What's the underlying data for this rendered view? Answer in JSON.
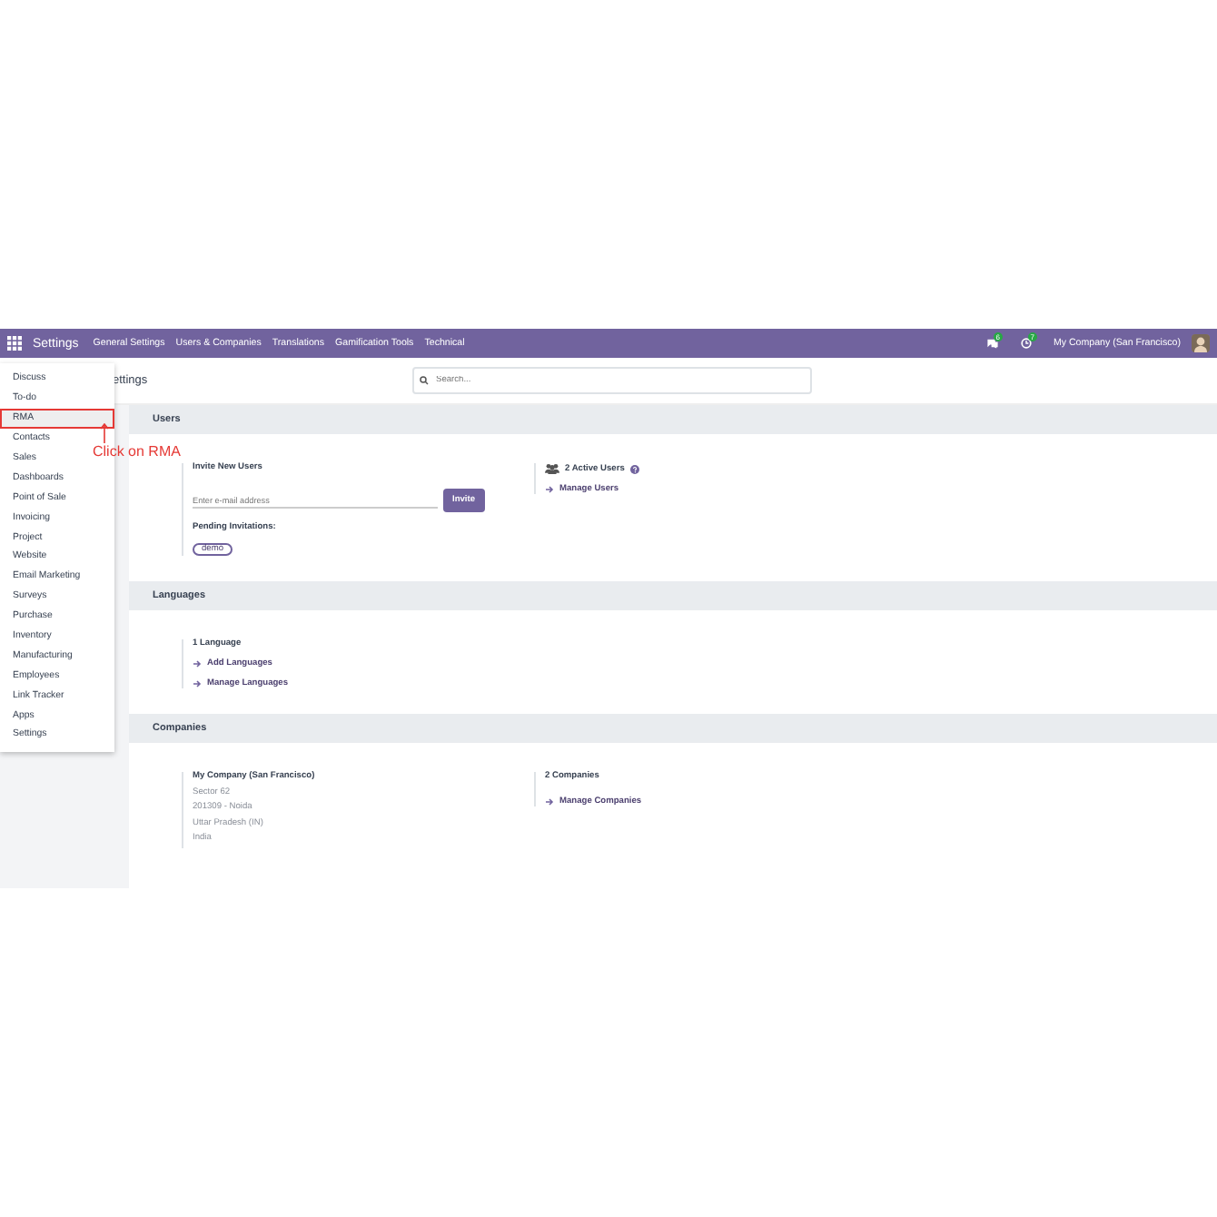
{
  "navbar": {
    "app_name": "Settings",
    "menu": [
      "General Settings",
      "Users & Companies",
      "Translations",
      "Gamification Tools",
      "Technical"
    ],
    "messages_badge": "6",
    "activities_badge": "7",
    "company": "My Company (San Francisco)"
  },
  "breadcrumb": "ettings",
  "search": {
    "placeholder": "Search..."
  },
  "app_menu": {
    "items": [
      {
        "label": "Discuss",
        "highlighted": false
      },
      {
        "label": "To-do",
        "highlighted": false
      },
      {
        "label": "RMA",
        "highlighted": true
      },
      {
        "label": "Contacts",
        "highlighted": false
      },
      {
        "label": "Sales",
        "highlighted": false
      },
      {
        "label": "Dashboards",
        "highlighted": false
      },
      {
        "label": "Point of Sale",
        "highlighted": false
      },
      {
        "label": "Invoicing",
        "highlighted": false
      },
      {
        "label": "Project",
        "highlighted": false
      },
      {
        "label": "Website",
        "highlighted": false
      },
      {
        "label": "Email Marketing",
        "highlighted": false
      },
      {
        "label": "Surveys",
        "highlighted": false
      },
      {
        "label": "Purchase",
        "highlighted": false
      },
      {
        "label": "Inventory",
        "highlighted": false
      },
      {
        "label": "Manufacturing",
        "highlighted": false
      },
      {
        "label": "Employees",
        "highlighted": false
      },
      {
        "label": "Link Tracker",
        "highlighted": false
      },
      {
        "label": "Apps",
        "highlighted": false
      },
      {
        "label": "Settings",
        "highlighted": false
      }
    ]
  },
  "annotation": {
    "text": "Click on RMA"
  },
  "users": {
    "title": "Users",
    "invite_label": "Invite New Users",
    "email_placeholder": "Enter e-mail address",
    "invite_button": "Invite",
    "pending_label": "Pending Invitations:",
    "pending": [
      "demo"
    ],
    "active_users": "2 Active Users",
    "manage_link": "Manage Users"
  },
  "languages": {
    "title": "Languages",
    "count": "1 Language",
    "links": [
      "Add Languages",
      "Manage Languages"
    ]
  },
  "companies": {
    "title": "Companies",
    "company_name": "My Company (San Francisco)",
    "address": [
      "Sector 62",
      "201309 - Noida",
      "Uttar Pradesh (IN)",
      "India"
    ],
    "count": "2 Companies",
    "manage_link": "Manage Companies"
  }
}
